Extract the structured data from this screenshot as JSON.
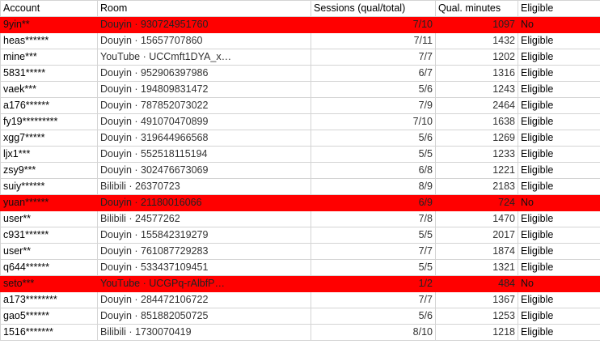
{
  "colors": {
    "flag_row": "#ff0000",
    "grid_line": "#d4d4d4"
  },
  "table": {
    "headers": [
      "Account",
      "Room",
      "Sessions (qual/total)",
      "Qual. minutes",
      "Eligible"
    ],
    "rows": [
      {
        "account": "9yin**",
        "room": "Douyin · 930724951760",
        "sessions": "7/10",
        "minutes": "1097",
        "eligible": "No",
        "flagged": true
      },
      {
        "account": "heas******",
        "room": "Douyin · 15657707860",
        "sessions": "7/11",
        "minutes": "1432",
        "eligible": "Eligible",
        "flagged": false
      },
      {
        "account": "mine***",
        "room": "YouTube · UCCmft1DYA_x…",
        "sessions": "7/7",
        "minutes": "1202",
        "eligible": "Eligible",
        "flagged": false
      },
      {
        "account": "5831*****",
        "room": "Douyin · 952906397986",
        "sessions": "6/7",
        "minutes": "1316",
        "eligible": "Eligible",
        "flagged": false
      },
      {
        "account": "vaek***",
        "room": "Douyin · 194809831472",
        "sessions": "5/6",
        "minutes": "1243",
        "eligible": "Eligible",
        "flagged": false
      },
      {
        "account": "a176******",
        "room": "Douyin · 787852073022",
        "sessions": "7/9",
        "minutes": "2464",
        "eligible": "Eligible",
        "flagged": false
      },
      {
        "account": "fy19*********",
        "room": "Douyin · 491070470899",
        "sessions": "7/10",
        "minutes": "1638",
        "eligible": "Eligible",
        "flagged": false
      },
      {
        "account": "xgg7*****",
        "room": "Douyin · 319644966568",
        "sessions": "5/6",
        "minutes": "1269",
        "eligible": "Eligible",
        "flagged": false
      },
      {
        "account": "ljx1***",
        "room": "Douyin · 552518115194",
        "sessions": "5/5",
        "minutes": "1233",
        "eligible": "Eligible",
        "flagged": false
      },
      {
        "account": "zsy9***",
        "room": "Douyin · 302476673069",
        "sessions": "6/8",
        "minutes": "1221",
        "eligible": "Eligible",
        "flagged": false
      },
      {
        "account": "suiy******",
        "room": "Bilibili · 26370723",
        "sessions": "8/9",
        "minutes": "2183",
        "eligible": "Eligible",
        "flagged": false
      },
      {
        "account": "yuan******",
        "room": "Douyin · 21180016066",
        "sessions": "6/9",
        "minutes": "724",
        "eligible": "No",
        "flagged": true
      },
      {
        "account": "user**",
        "room": "Bilibili · 24577262",
        "sessions": "7/8",
        "minutes": "1470",
        "eligible": "Eligible",
        "flagged": false
      },
      {
        "account": "c931******",
        "room": "Douyin · 155842319279",
        "sessions": "5/5",
        "minutes": "2017",
        "eligible": "Eligible",
        "flagged": false
      },
      {
        "account": "user**",
        "room": "Douyin · 761087729283",
        "sessions": "7/7",
        "minutes": "1874",
        "eligible": "Eligible",
        "flagged": false
      },
      {
        "account": "q644******",
        "room": "Douyin · 533437109451",
        "sessions": "5/5",
        "minutes": "1321",
        "eligible": "Eligible",
        "flagged": false
      },
      {
        "account": "seto***",
        "room": "YouTube · UCGPq-rAlbfP…",
        "sessions": "1/2",
        "minutes": "484",
        "eligible": "No",
        "flagged": true
      },
      {
        "account": "a173********",
        "room": "Douyin · 284472106722",
        "sessions": "7/7",
        "minutes": "1367",
        "eligible": "Eligible",
        "flagged": false
      },
      {
        "account": "gao5******",
        "room": "Douyin · 851882050725",
        "sessions": "5/6",
        "minutes": "1253",
        "eligible": "Eligible",
        "flagged": false
      },
      {
        "account": "1516*******",
        "room": "Bilibili · 1730070419",
        "sessions": "8/10",
        "minutes": "1218",
        "eligible": "Eligible",
        "flagged": false
      }
    ]
  }
}
